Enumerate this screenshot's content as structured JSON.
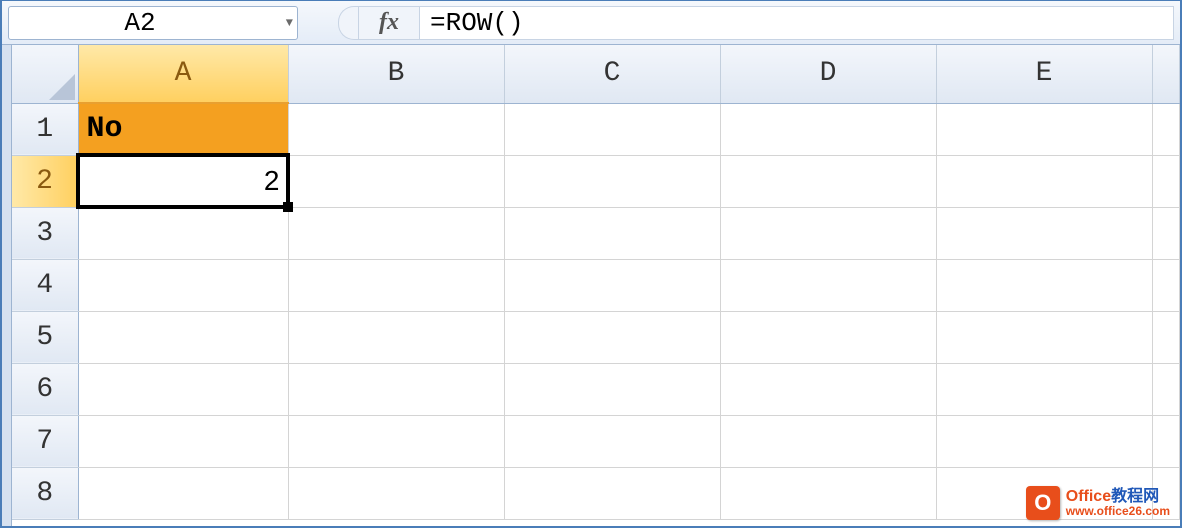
{
  "formula_bar": {
    "name_box": "A2",
    "fx_label": "fx",
    "formula": "=ROW()"
  },
  "columns": [
    "A",
    "B",
    "C",
    "D",
    "E"
  ],
  "active_column": "A",
  "rows": [
    "1",
    "2",
    "3",
    "4",
    "5",
    "6",
    "7",
    "8"
  ],
  "active_row": "2",
  "cells": {
    "A1": "No",
    "A2": "2"
  },
  "selected_cell": "A2",
  "watermark": {
    "icon": "O",
    "line1_a": "Office",
    "line1_b": "教程网",
    "line2": "www.office26.com"
  }
}
